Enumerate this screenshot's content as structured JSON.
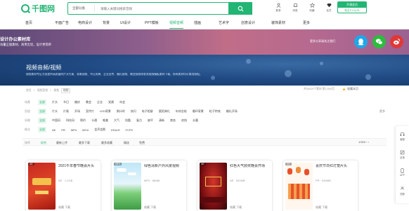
{
  "logo": {
    "text": "千图网"
  },
  "search": {
    "category": "全部分类",
    "placeholder": "请输入关键词搜索音频"
  },
  "top_icons": [
    {
      "label": "登录",
      "icon": "user-icon"
    },
    {
      "label": "消息",
      "icon": "bell-icon"
    },
    {
      "label": "收藏",
      "icon": "star-icon"
    },
    {
      "label": "会员",
      "icon": "diamond-icon"
    }
  ],
  "vip": {
    "top": "开通会员",
    "bottom": "低至0.2元/天"
  },
  "nav": {
    "items": [
      "首页",
      "平面广告",
      "电商设计",
      "背景",
      "UI设计",
      "PPT模板",
      "视频音频",
      "插画",
      "艺术字",
      "创意设计",
      "装饰素材",
      "更多"
    ],
    "active_index": 6
  },
  "promo": {
    "title": "设计办公素材库",
    "subtitle": "海量正版素材，商用无忧，设计更简单",
    "follow": "更多分享请关注我们",
    "social": [
      "qq-icon",
      "wechat-icon",
      "weibo-icon"
    ],
    "colors": {
      "qq": "#1ea7e8",
      "wechat": "#2bbd3c",
      "weibo": "#e03838"
    }
  },
  "hero": {
    "title": "视频音频/视频",
    "desc": "视频素材专区为您提供高质量的片头片尾、背景视频、节日庆典、企业宣传、婚礼视频、晚会视频等各类视频模板素材下载，所有素材均可商用授权。"
  },
  "breadcrumb": {
    "items": [
      "首页",
      "视频音频",
      "视频"
    ],
    "tag": "视频"
  },
  "stats": "共30029个素材  第1/300页",
  "favorite": "收藏本页",
  "filters": [
    {
      "label": "场景",
      "options": [
        "全部",
        "片头",
        "节日",
        "婚庆",
        "晚会",
        "企业",
        "党建",
        "年会"
      ],
      "active": 0
    },
    {
      "label": "用途",
      "options": [
        "全部",
        "片头",
        "片尾",
        "开场",
        "宣传片",
        "LED背景",
        "倒计时",
        "快闪",
        "电子相册",
        "颁奖典礼",
        "年终总结",
        "循环背景",
        "粒子特效",
        "婚礼开场"
      ],
      "active": 0
    },
    {
      "label": "风格",
      "options": [
        "全部",
        "中国风",
        "科技风",
        "简约",
        "卡通",
        "唯美",
        "大气",
        "炫酷",
        "复古",
        "扁平",
        "清新",
        "商务",
        "欢快",
        "水墨"
      ],
      "active": 0
    },
    {
      "label": "格式",
      "options": [
        "全部",
        "AE",
        "PR",
        "MP4",
        "MOV",
        "会声会影",
        "EDIUS",
        "FCPX"
      ],
      "active": 0
    }
  ],
  "filter_more": "更多",
  "sort": {
    "label": "排序",
    "options": [
      "综合",
      "最新上传",
      "最多下载",
      "最多收藏",
      "精选",
      "免费"
    ],
    "active": 0,
    "pager": "1/300  ‹ ›"
  },
  "cards": [
    {
      "title": "2021牛年春节晚会片头",
      "meta": "AE · 1.2GB",
      "btn": "收藏  下载",
      "tag": "AE",
      "thumb": "red"
    },
    {
      "title": "绿色清新户外风景视频",
      "meta": "MP4 · 86MB",
      "btn": "收藏  下载",
      "tag": "MP4",
      "thumb": "sky"
    },
    {
      "title": "红色大气颁奖晚会开场",
      "meta": "AE · 920MB",
      "btn": "收藏  下载",
      "tag": "AE",
      "thumb": "stage"
    },
    {
      "title": "喜庆节日红灯笼片头",
      "meta": "PR · 540MB",
      "btn": "收藏  下载",
      "tag": "PR",
      "thumb": "lantern"
    }
  ],
  "right_float": [
    {
      "label": "客服",
      "icon": "headset-icon"
    },
    {
      "label": "反馈",
      "icon": "edit-icon"
    },
    {
      "label": "APP",
      "icon": "phone-icon"
    },
    {
      "label": "顶部",
      "icon": "arrow-up-icon"
    }
  ],
  "colors": {
    "brand": "#22b573"
  }
}
